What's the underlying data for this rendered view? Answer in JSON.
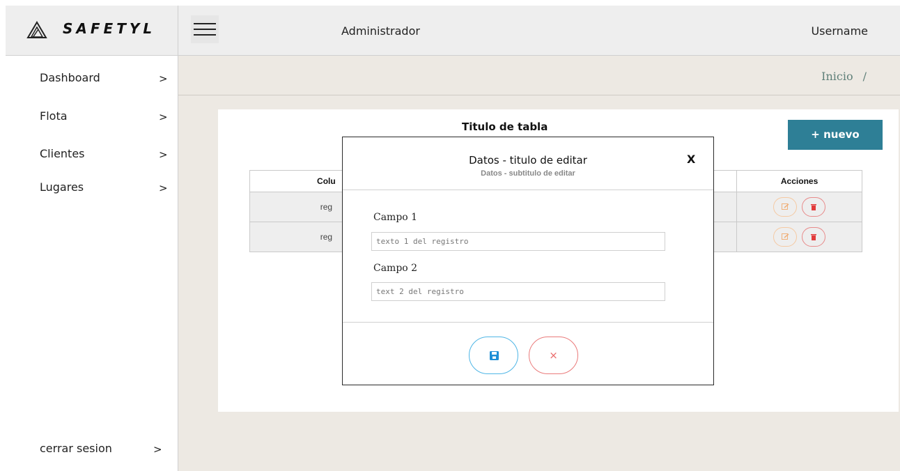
{
  "brand": {
    "name": "SAFETYL",
    "logo_icon": "triangle-logo-icon"
  },
  "sidebar": {
    "items": [
      {
        "label": "Dashboard",
        "chevron": ">"
      },
      {
        "label": "Flota",
        "chevron": ">"
      },
      {
        "label": "Clientes",
        "chevron": ">"
      },
      {
        "label": "Lugares",
        "chevron": ">"
      }
    ],
    "logout": {
      "label": "cerrar sesion",
      "chevron": ">"
    }
  },
  "header": {
    "menu_icon": "hamburger-icon",
    "role": "Administrador",
    "username": "Username"
  },
  "breadcrumb": {
    "home": "Inicio",
    "separator": "/"
  },
  "card": {
    "title": "Titulo de tabla",
    "new_button": "+ nuevo",
    "table": {
      "headers": [
        "Colu",
        "",
        "Acciones"
      ],
      "rows": [
        {
          "cells": [
            "reg",
            ""
          ],
          "edit_icon": "edit-icon",
          "delete_icon": "trash-icon"
        },
        {
          "cells": [
            "reg",
            ""
          ],
          "edit_icon": "edit-icon",
          "delete_icon": "trash-icon"
        }
      ]
    }
  },
  "modal": {
    "title": "Datos - titulo de editar",
    "subtitle": "Datos - subtitulo de editar",
    "close_label": "X",
    "fields": [
      {
        "label": "Campo 1",
        "value": "texto 1 del registro"
      },
      {
        "label": "Campo 2",
        "value": "text 2 del registro"
      }
    ],
    "save_icon": "save-floppy-icon",
    "cancel_label": "×"
  },
  "colors": {
    "header_bg": "#eeeeee",
    "content_bg": "#ede9e3",
    "primary_button": "#2e7f96",
    "save_border": "#4fb6e6",
    "cancel_border": "#ea7a7a",
    "breadcrumb_text": "#5e7f78"
  }
}
